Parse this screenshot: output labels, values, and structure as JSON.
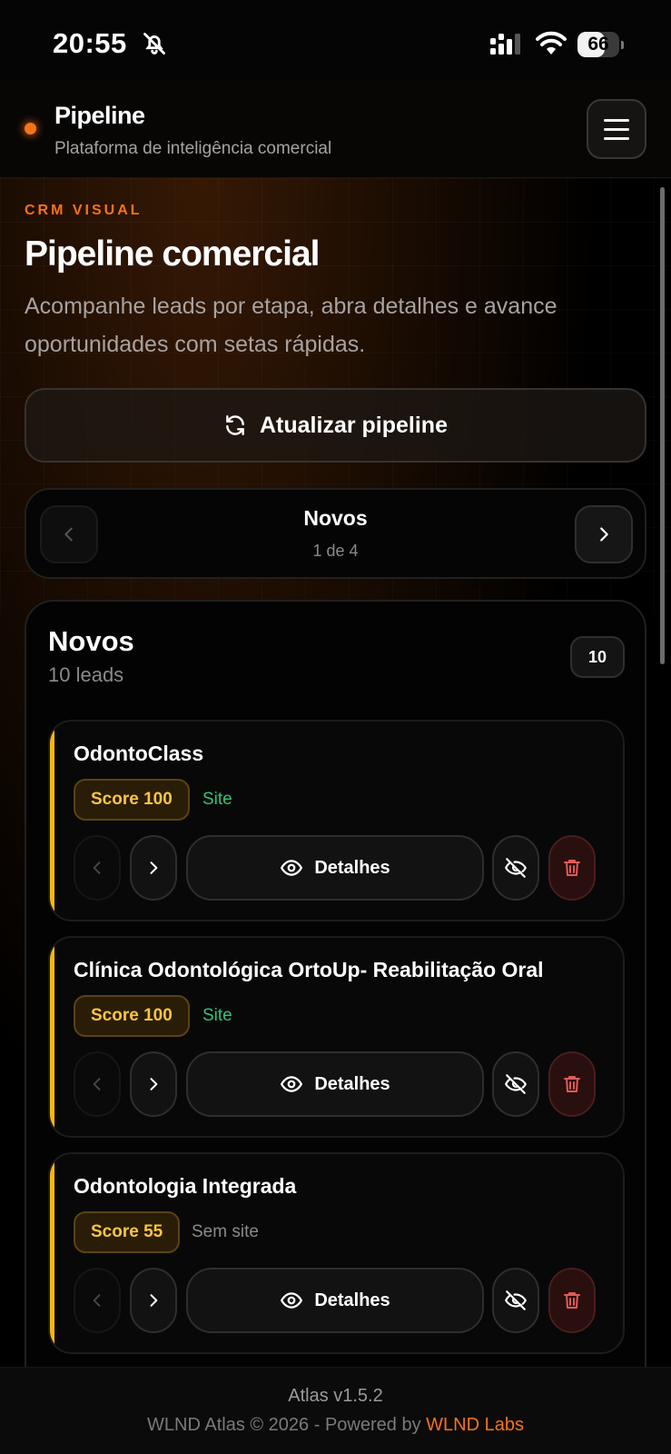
{
  "status_bar": {
    "time": "20:55",
    "battery": "66",
    "battery_level": 0.66
  },
  "header": {
    "title": "Pipeline",
    "subtitle": "Plataforma de inteligência comercial",
    "menu_icon": "hamburger-menu-icon"
  },
  "hero": {
    "eyebrow": "CRM VISUAL",
    "title": "Pipeline comercial",
    "description": "Acompanhe leads por etapa, abra detalhes e avance oportunidades com setas rápidas.",
    "refresh_label": "Atualizar pipeline"
  },
  "stage_nav": {
    "title": "Novos",
    "counter": "1 de 4"
  },
  "column": {
    "title": "Novos",
    "subtitle": "10 leads",
    "count": "10",
    "cards": [
      {
        "name": "OdontoClass",
        "score": "Score 100",
        "site": "Site",
        "site_status": "has-site",
        "details_label": "Detalhes"
      },
      {
        "name": "Clínica Odontológica OrtoUp- Reabilitação Oral",
        "score": "Score 100",
        "site": "Site",
        "site_status": "has-site",
        "details_label": "Detalhes"
      },
      {
        "name": "Odontologia Integrada",
        "score": "Score 55",
        "site": "Sem site",
        "site_status": "no-site",
        "details_label": "Detalhes"
      }
    ]
  },
  "footer": {
    "version": "Atlas v1.5.2",
    "copyright": "WLND Atlas © 2026 - Powered by",
    "brand": "WLND Labs"
  },
  "colors": {
    "accent": "#f97316",
    "card_accent": "#f5b70f",
    "score_text": "#fbc542",
    "site_green": "#34c37b",
    "delete_red": "#e05a5a"
  }
}
